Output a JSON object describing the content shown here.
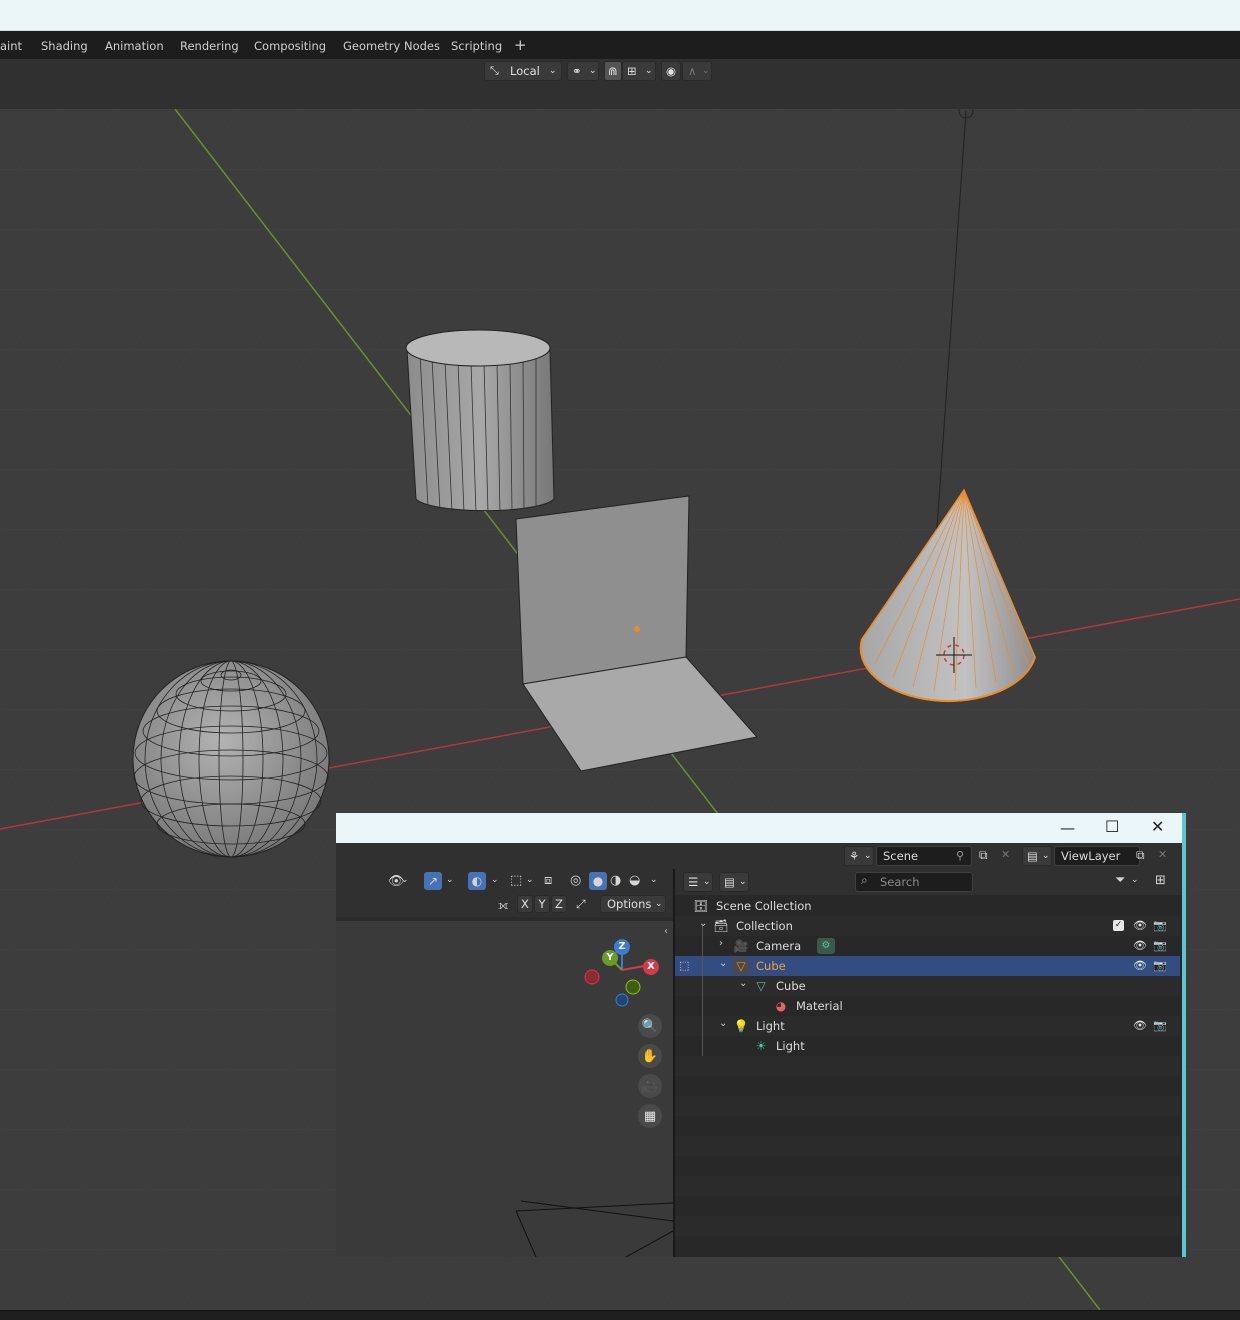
{
  "workspace_tabs": [
    "aint",
    "Shading",
    "Animation",
    "Rendering",
    "Compositing",
    "Geometry Nodes",
    "Scripting"
  ],
  "add_workspace_symbol": "+",
  "viewport_header": {
    "orientation_label": "Local",
    "icons": [
      "transform-orientation-icon",
      "pivot-icon",
      "snap-icon",
      "snap-target-icon",
      "proportional-edit-icon",
      "falloff-icon"
    ]
  },
  "colors": {
    "selection_orange": "#f08a24",
    "x_axis": "#b0383c",
    "y_axis": "#6a8f2b",
    "outliner_selected_row": "#334d80",
    "window_accent": "#5ec5d1"
  },
  "floating_window": {
    "controls": {
      "minimize": "—",
      "maximize": "☐",
      "close": "✕"
    },
    "scene_field": "Scene",
    "view_layer_field": "ViewLayer",
    "mini_viewport": {
      "mirror_axes": [
        "X",
        "Y",
        "Z"
      ],
      "options_label": "Options",
      "gizmo_labels": {
        "x": "X",
        "y": "Y",
        "z": "Z"
      }
    },
    "outliner": {
      "search_placeholder": "Search",
      "rows": [
        {
          "label": "Scene Collection",
          "icon": "scene-collection-icon"
        },
        {
          "label": "Collection",
          "icon": "collection-icon",
          "expanded": true
        },
        {
          "label": "Camera",
          "icon": "camera-object-icon",
          "expanded": false
        },
        {
          "label": "Cube",
          "icon": "mesh-object-icon",
          "expanded": true,
          "selected": true
        },
        {
          "label": "Cube",
          "icon": "mesh-data-icon",
          "expanded": true
        },
        {
          "label": "Material",
          "icon": "material-icon"
        },
        {
          "label": "Light",
          "icon": "light-object-icon",
          "expanded": true
        },
        {
          "label": "Light",
          "icon": "light-data-icon"
        }
      ]
    }
  }
}
